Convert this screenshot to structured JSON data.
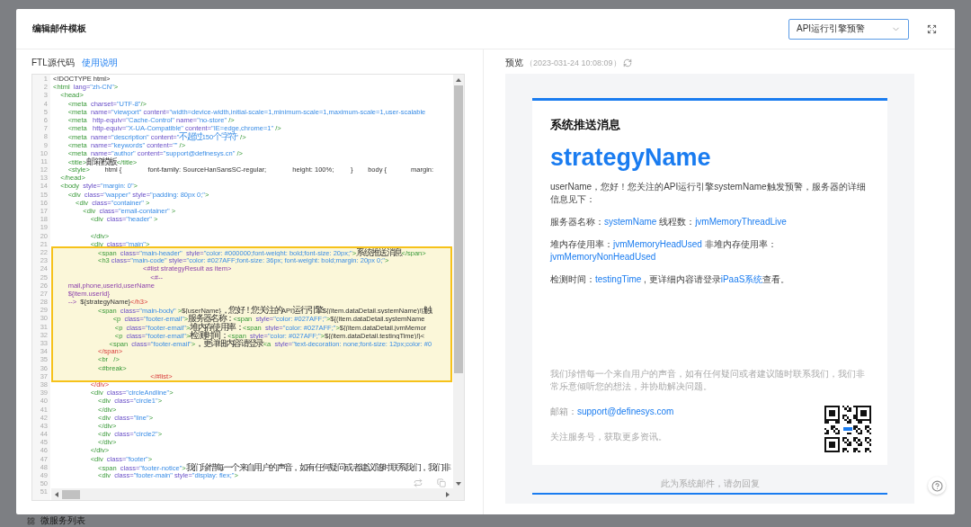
{
  "modal": {
    "title": "编辑邮件模板",
    "template_select": {
      "value": "API运行引擎预警"
    }
  },
  "source": {
    "label": "FTL源代码",
    "help_link": "使用说明"
  },
  "code": {
    "lines": [
      {
        "n": "1",
        "highlighted": false,
        "tokens": [
          {
            "kind": "text",
            "text": "<!DOCTYPE html>"
          }
        ]
      },
      {
        "n": "2",
        "highlighted": false,
        "tokens": [
          {
            "kind": "tag",
            "text": "<html  "
          },
          {
            "kind": "attr",
            "text": "lang="
          },
          {
            "kind": "val",
            "text": "\"zh-CN\""
          },
          {
            "kind": "tag",
            "text": ">"
          }
        ]
      },
      {
        "n": "3",
        "highlighted": false,
        "tokens": [
          {
            "kind": "tag",
            "text": "    <head>"
          }
        ]
      },
      {
        "n": "4",
        "highlighted": false,
        "tokens": [
          {
            "kind": "tag",
            "text": "        <meta  "
          },
          {
            "kind": "attr",
            "text": "charset="
          },
          {
            "kind": "val",
            "text": "\"UTF-8\""
          },
          {
            "kind": "tag",
            "text": "/>"
          }
        ]
      },
      {
        "n": "5",
        "highlighted": false,
        "tokens": [
          {
            "kind": "tag",
            "text": "        <meta  "
          },
          {
            "kind": "attr",
            "text": "name="
          },
          {
            "kind": "val",
            "text": "\"viewport\""
          },
          {
            "kind": "attr",
            "text": " content="
          },
          {
            "kind": "val",
            "text": "\"width=device-width,initial-scale=1,minimum-scale=1,maximum-scale=1,user-scalable"
          }
        ]
      },
      {
        "n": "6",
        "highlighted": false,
        "tokens": [
          {
            "kind": "tag",
            "text": "        <meta   "
          },
          {
            "kind": "attr",
            "text": "http-equiv="
          },
          {
            "kind": "val",
            "text": "\"Cache-Control\""
          },
          {
            "kind": "attr",
            "text": " name="
          },
          {
            "kind": "val",
            "text": "\"no-store\""
          },
          {
            "kind": "tag",
            "text": " />"
          }
        ]
      },
      {
        "n": "7",
        "highlighted": false,
        "tokens": [
          {
            "kind": "tag",
            "text": "        <meta   "
          },
          {
            "kind": "attr",
            "text": "http-equiv="
          },
          {
            "kind": "val",
            "text": "\"X-UA-Compatible\""
          },
          {
            "kind": "attr",
            "text": " content="
          },
          {
            "kind": "val",
            "text": "\"IE=edge,chrome=1\""
          },
          {
            "kind": "tag",
            "text": " />"
          }
        ]
      },
      {
        "n": "8",
        "highlighted": false,
        "tokens": [
          {
            "kind": "tag",
            "text": "        <meta  "
          },
          {
            "kind": "attr",
            "text": "name="
          },
          {
            "kind": "val",
            "text": "\"description\""
          },
          {
            "kind": "attr",
            "text": " content="
          },
          {
            "kind": "val",
            "text": "\"不超过150个字符\""
          },
          {
            "kind": "tag",
            "text": " />"
          }
        ]
      },
      {
        "n": "9",
        "highlighted": false,
        "tokens": [
          {
            "kind": "tag",
            "text": "        <meta  "
          },
          {
            "kind": "attr",
            "text": "name="
          },
          {
            "kind": "val",
            "text": "\"keywords\""
          },
          {
            "kind": "attr",
            "text": " content="
          },
          {
            "kind": "val",
            "text": "\"\""
          },
          {
            "kind": "tag",
            "text": " />"
          }
        ]
      },
      {
        "n": "10",
        "highlighted": false,
        "tokens": [
          {
            "kind": "tag",
            "text": "        <meta  "
          },
          {
            "kind": "attr",
            "text": "name="
          },
          {
            "kind": "val",
            "text": "\"author\""
          },
          {
            "kind": "attr",
            "text": " content="
          },
          {
            "kind": "val",
            "text": "\"support@definesys.cn\""
          },
          {
            "kind": "tag",
            "text": " />"
          }
        ]
      },
      {
        "n": "11",
        "highlighted": false,
        "tokens": [
          {
            "kind": "tag",
            "text": "        <title>"
          },
          {
            "kind": "text",
            "text": "邮箱模板"
          },
          {
            "kind": "tag",
            "text": "</title>"
          }
        ]
      },
      {
        "n": "12",
        "highlighted": false,
        "tokens": [
          {
            "kind": "tag",
            "text": "        <style>"
          },
          {
            "kind": "text",
            "text": "        html {              font-family: SourceHanSansSC-regular;              height: 100%;         }        body {             margin:"
          }
        ]
      },
      {
        "n": "13",
        "highlighted": false,
        "tokens": [
          {
            "kind": "tag",
            "text": "    </head>"
          }
        ]
      },
      {
        "n": "14",
        "highlighted": false,
        "tokens": [
          {
            "kind": "tag",
            "text": "    <body  "
          },
          {
            "kind": "attr",
            "text": "style="
          },
          {
            "kind": "val",
            "text": "\"margin: 0\""
          },
          {
            "kind": "tag",
            "text": ">"
          }
        ]
      },
      {
        "n": "15",
        "highlighted": false,
        "tokens": [
          {
            "kind": "tag",
            "text": "        <div  "
          },
          {
            "kind": "attr",
            "text": "class="
          },
          {
            "kind": "val",
            "text": "\"wapper\""
          },
          {
            "kind": "attr",
            "text": " style="
          },
          {
            "kind": "val",
            "text": "\"padding: 80px 0;\""
          },
          {
            "kind": "tag",
            "text": ">"
          }
        ]
      },
      {
        "n": "16",
        "highlighted": false,
        "tokens": [
          {
            "kind": "tag",
            "text": "            <div  "
          },
          {
            "kind": "attr",
            "text": "class="
          },
          {
            "kind": "val",
            "text": "\"container\""
          },
          {
            "kind": "tag",
            "text": " >"
          }
        ]
      },
      {
        "n": "17",
        "highlighted": false,
        "tokens": [
          {
            "kind": "tag",
            "text": "                <div  "
          },
          {
            "kind": "attr",
            "text": "class="
          },
          {
            "kind": "val",
            "text": "\"email-container\""
          },
          {
            "kind": "tag",
            "text": " >"
          }
        ]
      },
      {
        "n": "18",
        "highlighted": false,
        "tokens": [
          {
            "kind": "tag",
            "text": "                    <div  "
          },
          {
            "kind": "attr",
            "text": "class="
          },
          {
            "kind": "val",
            "text": "\"header\""
          },
          {
            "kind": "tag",
            "text": " >"
          }
        ]
      },
      {
        "n": "19",
        "highlighted": false
      },
      {
        "n": "20",
        "highlighted": false,
        "tokens": [
          {
            "kind": "tag",
            "text": "                    </div>"
          }
        ]
      },
      {
        "n": "21",
        "highlighted": false,
        "tokens": [
          {
            "kind": "tag",
            "text": "                    <div  "
          },
          {
            "kind": "attr",
            "text": "class="
          },
          {
            "kind": "val",
            "text": "\"main\""
          },
          {
            "kind": "tag",
            "text": ">"
          }
        ]
      },
      {
        "n": "22",
        "highlighted": true,
        "tokens": [
          {
            "kind": "tag",
            "text": "                        <span  "
          },
          {
            "kind": "attr",
            "text": "class="
          },
          {
            "kind": "val",
            "text": "\"main-header\""
          },
          {
            "kind": "attr",
            "text": "  style="
          },
          {
            "kind": "val",
            "text": "\"color: #000000;font-weight: bold;font-size: 20px;\""
          },
          {
            "kind": "tag",
            "text": ">"
          },
          {
            "kind": "text",
            "text": "系统推送消息"
          },
          {
            "kind": "tag",
            "text": "</span>"
          }
        ]
      },
      {
        "n": "23",
        "highlighted": true,
        "tokens": [
          {
            "kind": "tag",
            "text": "                        <h3 "
          },
          {
            "kind": "attr",
            "text": "class="
          },
          {
            "kind": "val",
            "text": "\"main-code\""
          },
          {
            "kind": "attr",
            "text": " style="
          },
          {
            "kind": "val",
            "text": "\"color: #027AFF;font-size: 36px; font-weight: bold;margin: 20px 0;\""
          },
          {
            "kind": "tag",
            "text": ">"
          }
        ]
      },
      {
        "n": "24",
        "highlighted": true,
        "tokens": [
          {
            "kind": "ftl",
            "text": "                                                <#list strategyResult as item>"
          }
        ]
      },
      {
        "n": "25",
        "highlighted": true,
        "tokens": [
          {
            "kind": "ftl",
            "text": "                                                    <#--"
          }
        ]
      },
      {
        "n": "26",
        "highlighted": true,
        "tokens": [
          {
            "kind": "ftl",
            "text": "        mail,phone,userId,userName"
          }
        ]
      },
      {
        "n": "27",
        "highlighted": true,
        "tokens": [
          {
            "kind": "ftl",
            "text": "        ${item.userId}"
          }
        ]
      },
      {
        "n": "28",
        "highlighted": true,
        "tokens": [
          {
            "kind": "ftl",
            "text": "        -->"
          },
          {
            "kind": "text",
            "text": "  ${strategyName}"
          },
          {
            "kind": "close",
            "text": "</h3>"
          }
        ]
      },
      {
        "n": "29",
        "highlighted": true,
        "tokens": [
          {
            "kind": "tag",
            "text": "                        <span  "
          },
          {
            "kind": "attr",
            "text": "class="
          },
          {
            "kind": "val",
            "text": "\"main-body\""
          },
          {
            "kind": "tag",
            "text": " >"
          },
          {
            "kind": "text",
            "text": "${userName}，您好！您关注的API运行引擎${(item.dataDetail.systemName)!}触"
          }
        ]
      },
      {
        "n": "30",
        "highlighted": true,
        "tokens": [
          {
            "kind": "tag",
            "text": "                                <p  "
          },
          {
            "kind": "attr",
            "text": "class="
          },
          {
            "kind": "val",
            "text": "\"footer-email\""
          },
          {
            "kind": "tag",
            "text": ">"
          },
          {
            "kind": "text",
            "text": "服务器名称："
          },
          {
            "kind": "tag",
            "text": "<span  "
          },
          {
            "kind": "attr",
            "text": "style="
          },
          {
            "kind": "val",
            "text": "\"color: #027AFF;\""
          },
          {
            "kind": "tag",
            "text": ">"
          },
          {
            "kind": "text",
            "text": "${(item.dataDetail.systemName"
          }
        ]
      },
      {
        "n": "31",
        "highlighted": true,
        "tokens": [
          {
            "kind": "tag",
            "text": "                                 <p  "
          },
          {
            "kind": "attr",
            "text": "class="
          },
          {
            "kind": "val",
            "text": "\"footer-email\""
          },
          {
            "kind": "tag",
            "text": ">"
          },
          {
            "kind": "text",
            "text": "堆内存使用率："
          },
          {
            "kind": "tag",
            "text": "<span  "
          },
          {
            "kind": "attr",
            "text": "style="
          },
          {
            "kind": "val",
            "text": "\"color: #027AFF;\""
          },
          {
            "kind": "tag",
            "text": ">"
          },
          {
            "kind": "text",
            "text": "${(item.dataDetail.jvmMemor"
          }
        ]
      },
      {
        "n": "32",
        "highlighted": true,
        "tokens": [
          {
            "kind": "tag",
            "text": "                                 <p  "
          },
          {
            "kind": "attr",
            "text": "class="
          },
          {
            "kind": "val",
            "text": "\"footer-email\""
          },
          {
            "kind": "tag",
            "text": ">"
          },
          {
            "kind": "text",
            "text": "检测时间："
          },
          {
            "kind": "tag",
            "text": "<span  "
          },
          {
            "kind": "attr",
            "text": "style="
          },
          {
            "kind": "val",
            "text": "\"color: #027AFF;\""
          },
          {
            "kind": "tag",
            "text": ">"
          },
          {
            "kind": "text",
            "text": "${(item.dataDetail.testingTime)!}<"
          }
        ]
      },
      {
        "n": "33",
        "highlighted": true,
        "tokens": [
          {
            "kind": "tag",
            "text": "                              <span  "
          },
          {
            "kind": "attr",
            "text": "class="
          },
          {
            "kind": "val",
            "text": "\"footer-email\""
          },
          {
            "kind": "tag",
            "text": ">"
          },
          {
            "kind": "text",
            "text": "，更详细内容请登录"
          },
          {
            "kind": "tag",
            "text": "<a  "
          },
          {
            "kind": "attr",
            "text": "style="
          },
          {
            "kind": "val",
            "text": "\"text-decoration: none;font-size: 12px;color: #0"
          }
        ]
      },
      {
        "n": "34",
        "highlighted": true,
        "tokens": [
          {
            "kind": "close",
            "text": "                        </span>"
          }
        ]
      },
      {
        "n": "35",
        "highlighted": true,
        "tokens": [
          {
            "kind": "tag",
            "text": "                        <br   />"
          }
        ]
      },
      {
        "n": "36",
        "highlighted": true,
        "tokens": [
          {
            "kind": "tag",
            "text": "                        <#break>"
          }
        ]
      },
      {
        "n": "37",
        "highlighted": true,
        "tokens": [
          {
            "kind": "close",
            "text": "                                                    </#list>"
          }
        ]
      },
      {
        "n": "38",
        "highlighted": false,
        "tokens": [
          {
            "kind": "close",
            "text": "                    </div>"
          }
        ]
      },
      {
        "n": "39",
        "highlighted": false,
        "tokens": [
          {
            "kind": "tag",
            "text": "                    <div  "
          },
          {
            "kind": "attr",
            "text": "class="
          },
          {
            "kind": "val",
            "text": "\"circleAndline\""
          },
          {
            "kind": "tag",
            "text": ">"
          }
        ]
      },
      {
        "n": "40",
        "highlighted": false,
        "tokens": [
          {
            "kind": "tag",
            "text": "                        <div  "
          },
          {
            "kind": "attr",
            "text": "class="
          },
          {
            "kind": "val",
            "text": "\"circle1\""
          },
          {
            "kind": "tag",
            "text": ">"
          }
        ]
      },
      {
        "n": "41",
        "highlighted": false,
        "tokens": [
          {
            "kind": "tag",
            "text": "                        </div>"
          }
        ]
      },
      {
        "n": "42",
        "highlighted": false,
        "tokens": [
          {
            "kind": "tag",
            "text": "                        <div  "
          },
          {
            "kind": "attr",
            "text": "class="
          },
          {
            "kind": "val",
            "text": "\"line\""
          },
          {
            "kind": "tag",
            "text": ">"
          }
        ]
      },
      {
        "n": "43",
        "highlighted": false,
        "tokens": [
          {
            "kind": "tag",
            "text": "                        </div>"
          }
        ]
      },
      {
        "n": "44",
        "highlighted": false,
        "tokens": [
          {
            "kind": "tag",
            "text": "                        <div  "
          },
          {
            "kind": "attr",
            "text": "class="
          },
          {
            "kind": "val",
            "text": "\"circle2\""
          },
          {
            "kind": "tag",
            "text": ">"
          }
        ]
      },
      {
        "n": "45",
        "highlighted": false,
        "tokens": [
          {
            "kind": "tag",
            "text": "                        </div>"
          }
        ]
      },
      {
        "n": "46",
        "highlighted": false,
        "tokens": [
          {
            "kind": "tag",
            "text": "                    </div>"
          }
        ]
      },
      {
        "n": "47",
        "highlighted": false,
        "tokens": [
          {
            "kind": "tag",
            "text": "                    <div  "
          },
          {
            "kind": "attr",
            "text": "class="
          },
          {
            "kind": "val",
            "text": "\"footer\""
          },
          {
            "kind": "tag",
            "text": ">"
          }
        ]
      },
      {
        "n": "48",
        "highlighted": false,
        "tokens": [
          {
            "kind": "tag",
            "text": "                        <span  "
          },
          {
            "kind": "attr",
            "text": "class="
          },
          {
            "kind": "val",
            "text": "\"footer-notice\""
          },
          {
            "kind": "tag",
            "text": ">"
          },
          {
            "kind": "text",
            "text": "我们珍惜每一个来自用户的声音，如有任何疑问或者建议随时联系我们，我们非"
          }
        ]
      },
      {
        "n": "49",
        "highlighted": false,
        "tokens": [
          {
            "kind": "tag",
            "text": "                        <div  "
          },
          {
            "kind": "attr",
            "text": "class="
          },
          {
            "kind": "val",
            "text": "\"footer-main\""
          },
          {
            "kind": "attr",
            "text": " style="
          },
          {
            "kind": "val",
            "text": "\"display: flex;\""
          },
          {
            "kind": "tag",
            "text": ">"
          }
        ]
      },
      {
        "n": "50",
        "highlighted": false
      },
      {
        "n": "51",
        "highlighted": false
      }
    ]
  },
  "preview": {
    "label": "预览",
    "time": "（2023-031-24 10:08:09）"
  },
  "email": {
    "heading": "系统推送消息",
    "title": "strategyName",
    "paragraphs": [
      [
        {
          "kind": "text",
          "text": "userName，您好！您关注的API运行引擎systemName触发预警，服务器的详细信息见下："
        }
      ],
      [
        {
          "kind": "text",
          "text": "服务器名称："
        },
        {
          "kind": "var",
          "text": "systemName"
        },
        {
          "kind": "text",
          "text": " 线程数："
        },
        {
          "kind": "var",
          "text": "jvmMemoryThreadLive"
        }
      ],
      [
        {
          "kind": "text",
          "text": "堆内存使用率："
        },
        {
          "kind": "var",
          "text": "jvmMemoryHeadUsed"
        },
        {
          "kind": "text",
          "text": " 非堆内存使用率："
        },
        {
          "kind": "var",
          "text": "jvmMemoryNonHeadUsed"
        }
      ],
      [
        {
          "kind": "text",
          "text": "检测时间："
        },
        {
          "kind": "var",
          "text": "testingTime"
        },
        {
          "kind": "text",
          "text": " , 更详细内容请登录"
        },
        {
          "kind": "link",
          "text": "iPaaS系统"
        },
        {
          "kind": "text",
          "text": "查看。"
        }
      ]
    ],
    "notice": "我们珍惜每一个来自用户的声音，如有任何疑问或者建议随时联系我们，我们非常乐意倾听您的想法，并协助解决问题。",
    "contact": [
      {
        "kind": "text",
        "text": "邮箱："
      },
      {
        "kind": "link",
        "text": "support@definesys.com"
      }
    ],
    "follow": "关注服务号，获取更多资讯。",
    "footer": "此为系统邮件，请勿回复"
  },
  "background_nav": {
    "label": "微服务列表"
  }
}
